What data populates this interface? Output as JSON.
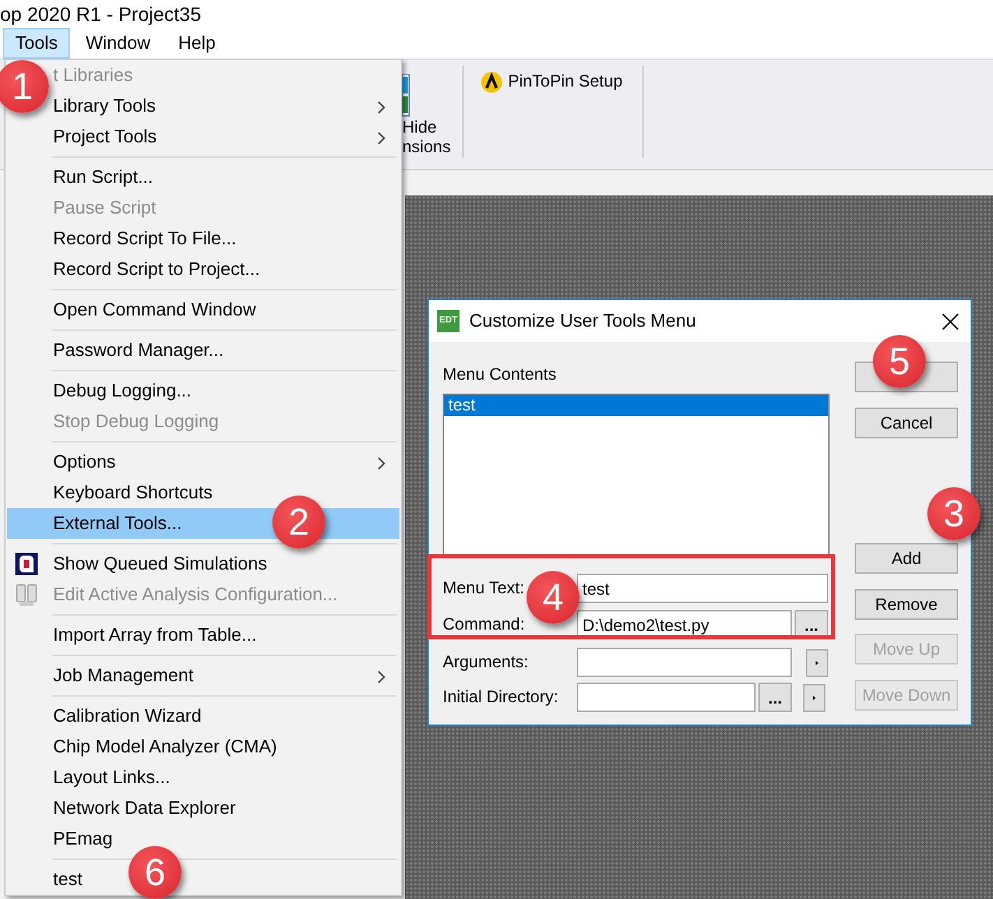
{
  "window": {
    "title": "op 2020 R1 - Project35"
  },
  "menubar": [
    {
      "label": "Tools",
      "selected": true
    },
    {
      "label": "Window",
      "selected": false
    },
    {
      "label": "Help",
      "selected": false
    }
  ],
  "ribbon": {
    "buttons": [
      {
        "kind": "layout",
        "lines": [
          "Hide",
          "nsions"
        ]
      },
      {
        "kind": "pin",
        "lines": [
          "PinToPin Setup"
        ]
      }
    ]
  },
  "tools_menu": [
    {
      "kind": "item",
      "label": "t Libraries",
      "disabled": true,
      "selected": false,
      "submenu": false
    },
    {
      "kind": "item",
      "label": "Library Tools",
      "disabled": false,
      "selected": false,
      "submenu": true
    },
    {
      "kind": "item",
      "label": "Project Tools",
      "disabled": false,
      "selected": false,
      "submenu": true
    },
    {
      "kind": "separator"
    },
    {
      "kind": "item",
      "label": "Run Script...",
      "disabled": false,
      "selected": false,
      "submenu": false
    },
    {
      "kind": "item",
      "label": "Pause Script",
      "disabled": true,
      "selected": false,
      "submenu": false
    },
    {
      "kind": "item",
      "label": "Record Script To File...",
      "disabled": false,
      "selected": false,
      "submenu": false
    },
    {
      "kind": "item",
      "label": "Record Script to Project...",
      "disabled": false,
      "selected": false,
      "submenu": false
    },
    {
      "kind": "separator"
    },
    {
      "kind": "item",
      "label": "Open Command Window",
      "disabled": false,
      "selected": false,
      "submenu": false
    },
    {
      "kind": "separator"
    },
    {
      "kind": "item",
      "label": "Password Manager...",
      "disabled": false,
      "selected": false,
      "submenu": false
    },
    {
      "kind": "separator"
    },
    {
      "kind": "item",
      "label": "Debug Logging...",
      "disabled": false,
      "selected": false,
      "submenu": false
    },
    {
      "kind": "item",
      "label": "Stop Debug Logging",
      "disabled": true,
      "selected": false,
      "submenu": false
    },
    {
      "kind": "separator"
    },
    {
      "kind": "item",
      "label": "Options",
      "disabled": false,
      "selected": false,
      "submenu": true
    },
    {
      "kind": "item",
      "label": "Keyboard Shortcuts",
      "disabled": false,
      "selected": false,
      "submenu": false
    },
    {
      "kind": "item",
      "label": "External Tools...",
      "disabled": false,
      "selected": true,
      "submenu": false
    },
    {
      "kind": "separator"
    },
    {
      "kind": "queue-item",
      "label": "Show Queued Simulations",
      "disabled": false,
      "selected": false,
      "submenu": false
    },
    {
      "kind": "config-item",
      "label": "Edit Active Analysis Configuration...",
      "disabled": true,
      "selected": false,
      "submenu": false
    },
    {
      "kind": "separator"
    },
    {
      "kind": "item",
      "label": "Import Array from Table...",
      "disabled": false,
      "selected": false,
      "submenu": false
    },
    {
      "kind": "separator"
    },
    {
      "kind": "item",
      "label": "Job Management",
      "disabled": false,
      "selected": false,
      "submenu": true
    },
    {
      "kind": "separator"
    },
    {
      "kind": "item",
      "label": "Calibration Wizard",
      "disabled": false,
      "selected": false,
      "submenu": false
    },
    {
      "kind": "item",
      "label": "Chip Model Analyzer (CMA)",
      "disabled": false,
      "selected": false,
      "submenu": false
    },
    {
      "kind": "item",
      "label": "Layout Links...",
      "disabled": false,
      "selected": false,
      "submenu": false
    },
    {
      "kind": "item",
      "label": "Network Data Explorer",
      "disabled": false,
      "selected": false,
      "submenu": false
    },
    {
      "kind": "item",
      "label": "PEmag",
      "disabled": false,
      "selected": false,
      "submenu": false
    },
    {
      "kind": "separator"
    },
    {
      "kind": "item",
      "label": "test",
      "disabled": false,
      "selected": false,
      "submenu": false
    }
  ],
  "dialog": {
    "logo": "EDT",
    "title": "Customize User Tools Menu",
    "list_label": "Menu Contents",
    "list_items": [
      {
        "label": "test",
        "selected": true
      }
    ],
    "fields": [
      {
        "label": "Menu Text:",
        "value": "test",
        "arrow": false
      },
      {
        "label": "Command:",
        "value": "D:\\demo2\\test.py",
        "browse": "...",
        "arrow": false
      },
      {
        "label": "Arguments:",
        "arrow": true
      },
      {
        "label": "Initial Directory:",
        "browse": "...",
        "arrow": true
      }
    ],
    "buttons": [
      {
        "disabled": false
      },
      {
        "label": "Cancel",
        "disabled": false
      },
      {
        "label": "Add",
        "disabled": false
      },
      {
        "label": "Remove",
        "disabled": false
      },
      {
        "label": "Move Up",
        "disabled": true
      },
      {
        "label": "Move Down",
        "disabled": true
      }
    ]
  },
  "annotations": {
    "frame": true,
    "callouts": [
      "1",
      "2",
      "3",
      "4",
      "5",
      "6"
    ]
  }
}
